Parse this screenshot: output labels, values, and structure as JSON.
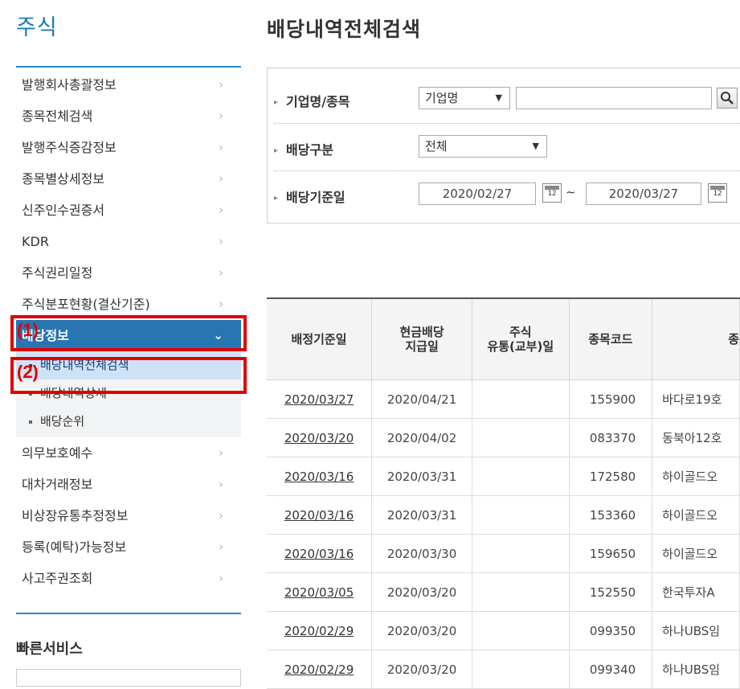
{
  "sidebar": {
    "title": "주식",
    "items": [
      {
        "label": "발행회사총괄정보"
      },
      {
        "label": "종목전체검색"
      },
      {
        "label": "발행주식증감정보"
      },
      {
        "label": "종목별상세정보"
      },
      {
        "label": "신주인수권증서"
      },
      {
        "label": "KDR"
      },
      {
        "label": "주식권리일정"
      },
      {
        "label": "주식분포현황(결산기준)"
      },
      {
        "label": "배당정보"
      },
      {
        "label": "의무보호예수"
      },
      {
        "label": "대차거래정보"
      },
      {
        "label": "비상장유통추정정보"
      },
      {
        "label": "등록(예탁)가능정보"
      },
      {
        "label": "사고주권조회"
      }
    ],
    "submenu": [
      {
        "label": "배당내역전체검색"
      },
      {
        "label": "배당내역상세"
      },
      {
        "label": "배당순위"
      }
    ],
    "chevron": "›",
    "chevron_open": "⌄",
    "quick_title": "빠른서비스"
  },
  "annotations": {
    "one": "(1)",
    "two": "(2)"
  },
  "page_title": "배당내역전체검색",
  "search": {
    "company_label": "기업명/종목",
    "company_select": "기업명",
    "company_input": "",
    "type_label": "배당구분",
    "type_select": "전체",
    "date_label": "배당기준일",
    "date_from": "2020/02/27",
    "date_to": "2020/03/27",
    "tilde": "~",
    "calendar_num": "12"
  },
  "table": {
    "headers": [
      "배정기준일",
      "현금배당\n지급일",
      "주식\n유통(교부)일",
      "종목코드",
      "종"
    ],
    "rows": [
      [
        "2020/03/27",
        "2020/04/21",
        "",
        "155900",
        "바다로19호"
      ],
      [
        "2020/03/20",
        "2020/04/02",
        "",
        "083370",
        "동북아12호"
      ],
      [
        "2020/03/16",
        "2020/03/31",
        "",
        "172580",
        "하이골드오"
      ],
      [
        "2020/03/16",
        "2020/03/31",
        "",
        "153360",
        "하이골드오"
      ],
      [
        "2020/03/16",
        "2020/03/30",
        "",
        "159650",
        "하이골드오"
      ],
      [
        "2020/03/05",
        "2020/03/20",
        "",
        "152550",
        "한국투자A"
      ],
      [
        "2020/02/29",
        "2020/03/20",
        "",
        "099350",
        "하나UBS임"
      ],
      [
        "2020/02/29",
        "2020/03/20",
        "",
        "099340",
        "하나UBS임"
      ]
    ]
  },
  "colors": {
    "accent": "#2775b3",
    "title_blue": "#1a7bb8",
    "annotation": "#e00000"
  }
}
